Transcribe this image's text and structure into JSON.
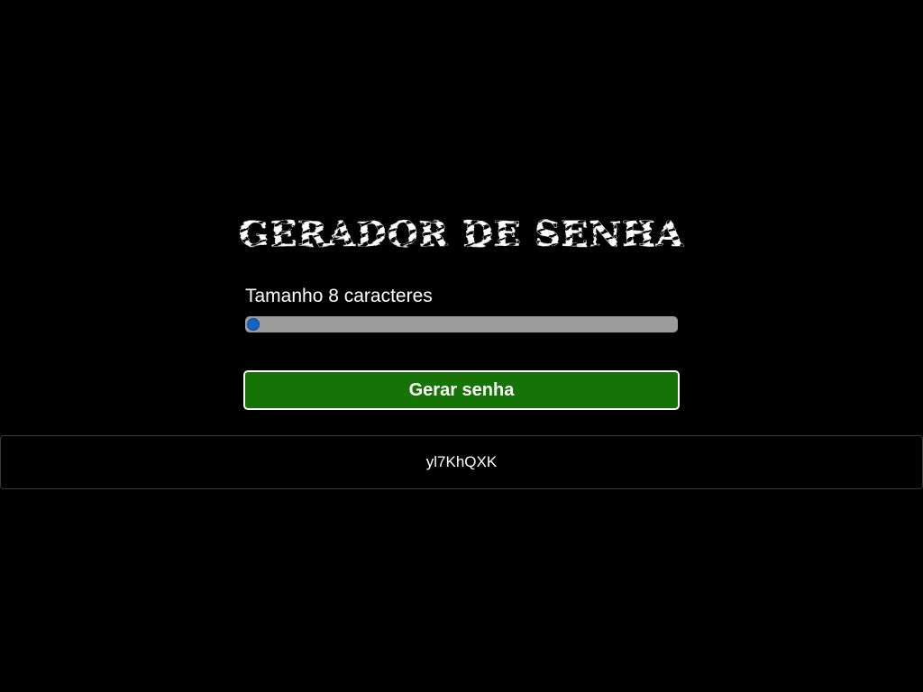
{
  "header": {
    "title": "GERADOR DE SENHA"
  },
  "length_control": {
    "label": "Tamanho 8 caracteres",
    "value": 8,
    "min": 8,
    "max": 128
  },
  "actions": {
    "generate_label": "Gerar senha"
  },
  "result": {
    "password": "yl7KhQXK"
  },
  "colors": {
    "background": "#000000",
    "button": "#157405",
    "slider_track": "#9b9b9b",
    "slider_thumb": "#1565c0"
  }
}
